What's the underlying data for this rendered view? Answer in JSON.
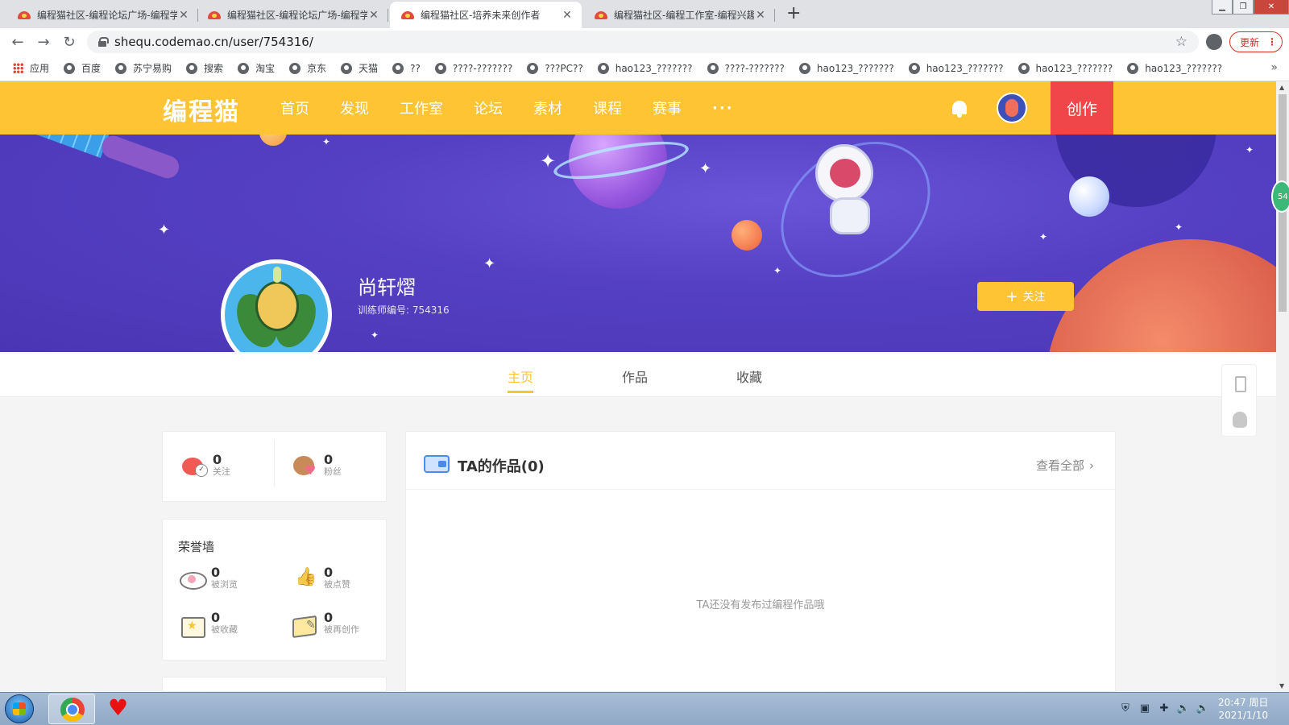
{
  "browser": {
    "tabs": [
      {
        "title": "编程猫社区-编程论坛广场-编程学",
        "active": false
      },
      {
        "title": "编程猫社区-编程论坛广场-编程学",
        "active": false
      },
      {
        "title": "编程猫社区-培养未来创作者",
        "active": true
      },
      {
        "title": "编程猫社区-编程工作室-编程兴趣",
        "active": false
      }
    ],
    "url": "shequ.codemao.cn/user/754316/",
    "update_label": "更新",
    "bookmarks": [
      {
        "label": "应用",
        "icon": "apps-grid-icon"
      },
      {
        "label": "百度",
        "icon": "globe-icon"
      },
      {
        "label": "苏宁易购",
        "icon": "globe-icon"
      },
      {
        "label": "搜索",
        "icon": "globe-icon"
      },
      {
        "label": "淘宝",
        "icon": "globe-icon"
      },
      {
        "label": "京东",
        "icon": "globe-icon"
      },
      {
        "label": "天猫",
        "icon": "globe-icon"
      },
      {
        "label": "??",
        "icon": "globe-icon"
      },
      {
        "label": "????-???????",
        "icon": "globe-icon"
      },
      {
        "label": "???PC??",
        "icon": "globe-icon"
      },
      {
        "label": "hao123_???????",
        "icon": "globe-icon"
      },
      {
        "label": "????-???????",
        "icon": "globe-icon"
      },
      {
        "label": "hao123_???????",
        "icon": "globe-icon"
      },
      {
        "label": "hao123_???????",
        "icon": "globe-icon"
      },
      {
        "label": "hao123_???????",
        "icon": "globe-icon"
      },
      {
        "label": "hao123_???????",
        "icon": "globe-icon"
      }
    ]
  },
  "site": {
    "logo": "编程猫",
    "nav": [
      "首页",
      "发现",
      "工作室",
      "论坛",
      "素材",
      "课程",
      "赛事",
      "···"
    ],
    "create_label": "创作",
    "accent_color": "#fec433",
    "create_color": "#f0464a"
  },
  "profile": {
    "name": "尚轩熠",
    "trainer_id": "训练师编号: 754316",
    "follow_label": "关注",
    "tabs": [
      "主页",
      "作品",
      "收藏"
    ],
    "active_tab": "主页"
  },
  "stats": {
    "following": {
      "value": "0",
      "label": "关注"
    },
    "fans": {
      "value": "0",
      "label": "粉丝"
    }
  },
  "honor": {
    "title": "荣誉墙",
    "items": [
      {
        "value": "0",
        "label": "被浏览"
      },
      {
        "value": "0",
        "label": "被点赞"
      },
      {
        "value": "0",
        "label": "被收藏"
      },
      {
        "value": "0",
        "label": "被再创作"
      }
    ]
  },
  "works": {
    "title": "TA的作品(0)",
    "view_all": "查看全部",
    "empty": "TA还没有发布过编程作品哦"
  },
  "edge_badge": "54",
  "taskbar": {
    "time": "20:47 周日",
    "date": "2021/1/10"
  }
}
